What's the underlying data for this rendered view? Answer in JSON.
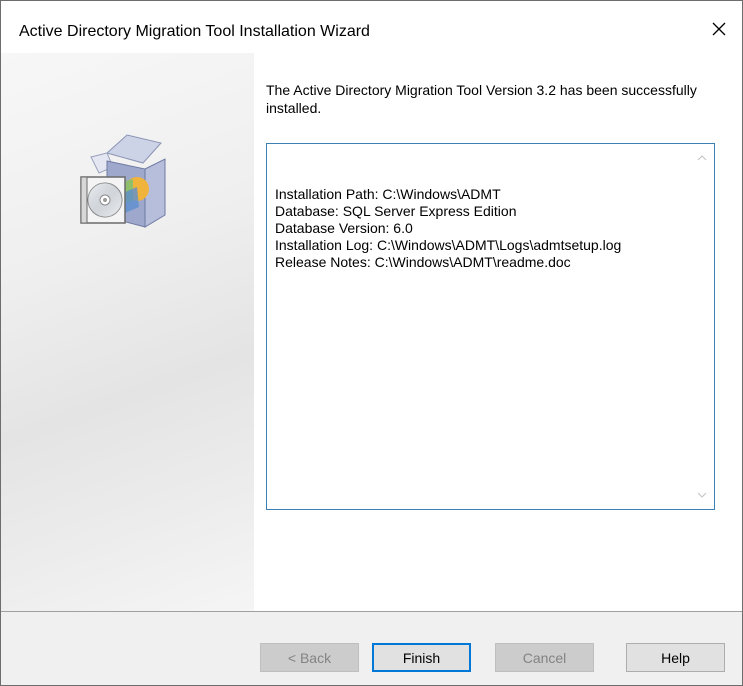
{
  "window": {
    "title": "Active Directory Migration Tool Installation Wizard"
  },
  "content": {
    "message": "The Active Directory Migration Tool Version 3.2 has been successfully installed.",
    "info_lines": [
      "Installation Path: C:\\Windows\\ADMT",
      "Database: SQL Server Express Edition",
      "Database Version: 6.0",
      "Installation Log: C:\\Windows\\ADMT\\Logs\\admtsetup.log",
      "Release Notes: C:\\Windows\\ADMT\\readme.doc"
    ]
  },
  "buttons": {
    "back": "< Back",
    "finish": "Finish",
    "cancel": "Cancel",
    "help": "Help"
  },
  "icons": {
    "close": "close-icon",
    "package": "software-package-icon",
    "scroll_up": "chevron-up-icon",
    "scroll_down": "chevron-down-icon"
  },
  "colors": {
    "focus_border": "#0078d7",
    "textbox_border": "#3c7fb1",
    "footer_bg": "#f0f0f0"
  }
}
